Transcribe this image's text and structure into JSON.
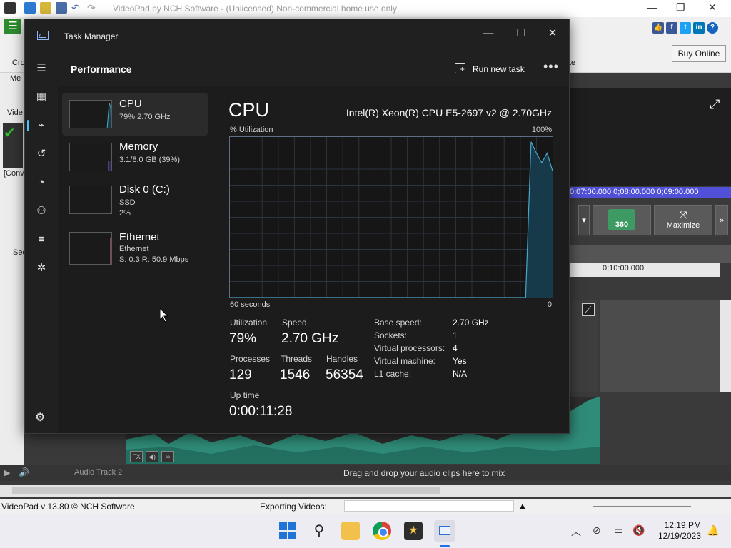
{
  "videopad": {
    "window_title": "VideoPad by NCH Software - (Unlicensed) Non-commercial home use only",
    "buy_online": "Buy Online",
    "ribbon_crop_label": "Cro",
    "ribbon_rite_label": "te",
    "left_tab_me": "Me",
    "left_vide": "Vide",
    "left_conv": "[Conv",
    "left_sec": "Sec",
    "time_ruler_text": "0:07:00.000    0;08:00.000    0;09:00.000",
    "seq_ruler_text": "0;10:00.000",
    "btn_360_label": "360",
    "btn_maximize_label": "Maximize",
    "audio_track_2_label": "Audio Track 2",
    "drag_hint": "Drag and drop your audio clips here to mix",
    "status_version": "VideoPad v 13.80 © NCH Software",
    "exporting_label": "Exporting Videos:",
    "export_progress": 0
  },
  "task_manager": {
    "title": "Task Manager",
    "section_title": "Performance",
    "run_new_task": "Run new task",
    "resources": [
      {
        "name": "CPU",
        "line1": "79%  2.70 GHz",
        "line2": ""
      },
      {
        "name": "Memory",
        "line1": "3.1/8.0 GB (39%)",
        "line2": ""
      },
      {
        "name": "Disk 0 (C:)",
        "line1": "SSD",
        "line2": "2%"
      },
      {
        "name": "Ethernet",
        "line1": "Ethernet",
        "line2": "S: 0.3  R: 50.9 Mbps"
      }
    ],
    "detail": {
      "heading": "CPU",
      "model": "Intel(R) Xeon(R) CPU E5-2697 v2 @ 2.70GHz",
      "util_label": "% Utilization",
      "util_max": "100%",
      "graph_left": "60 seconds",
      "graph_right": "0",
      "stats": {
        "utilization_label": "Utilization",
        "utilization_value": "79%",
        "speed_label": "Speed",
        "speed_value": "2.70 GHz",
        "processes_label": "Processes",
        "processes_value": "129",
        "threads_label": "Threads",
        "threads_value": "1546",
        "handles_label": "Handles",
        "handles_value": "56354",
        "uptime_label": "Up time",
        "uptime_value": "0:00:11:28"
      },
      "specs": [
        {
          "k": "Base speed:",
          "v": "2.70 GHz"
        },
        {
          "k": "Sockets:",
          "v": "1"
        },
        {
          "k": "Virtual processors:",
          "v": "4"
        },
        {
          "k": "Virtual machine:",
          "v": "Yes"
        },
        {
          "k": "L1 cache:",
          "v": "N/A"
        }
      ]
    },
    "cpu_history_percent": [
      0,
      0,
      0,
      0,
      0,
      0,
      0,
      0,
      0,
      0,
      0,
      0,
      0,
      0,
      0,
      0,
      0,
      0,
      0,
      0,
      0,
      0,
      0,
      0,
      0,
      0,
      0,
      0,
      0,
      0,
      0,
      0,
      0,
      0,
      0,
      0,
      0,
      0,
      0,
      0,
      0,
      0,
      0,
      0,
      0,
      0,
      0,
      0,
      0,
      0,
      0,
      0,
      0,
      0,
      0,
      0,
      97,
      90,
      84,
      90,
      79
    ],
    "colors": {
      "cpu_line": "#4aa6c8",
      "cpu_fill": "#173a4a",
      "accent": "#4cc2ff",
      "ethernet": "#c06080",
      "disk": "#6fae3f",
      "memory": "#7a6bd0"
    }
  },
  "taskbar": {
    "time": "12:19 PM",
    "date": "12/19/2023",
    "icons": [
      "start-icon",
      "search-icon",
      "file-explorer-icon",
      "chrome-icon",
      "videopad-icon",
      "task-manager-icon"
    ]
  }
}
